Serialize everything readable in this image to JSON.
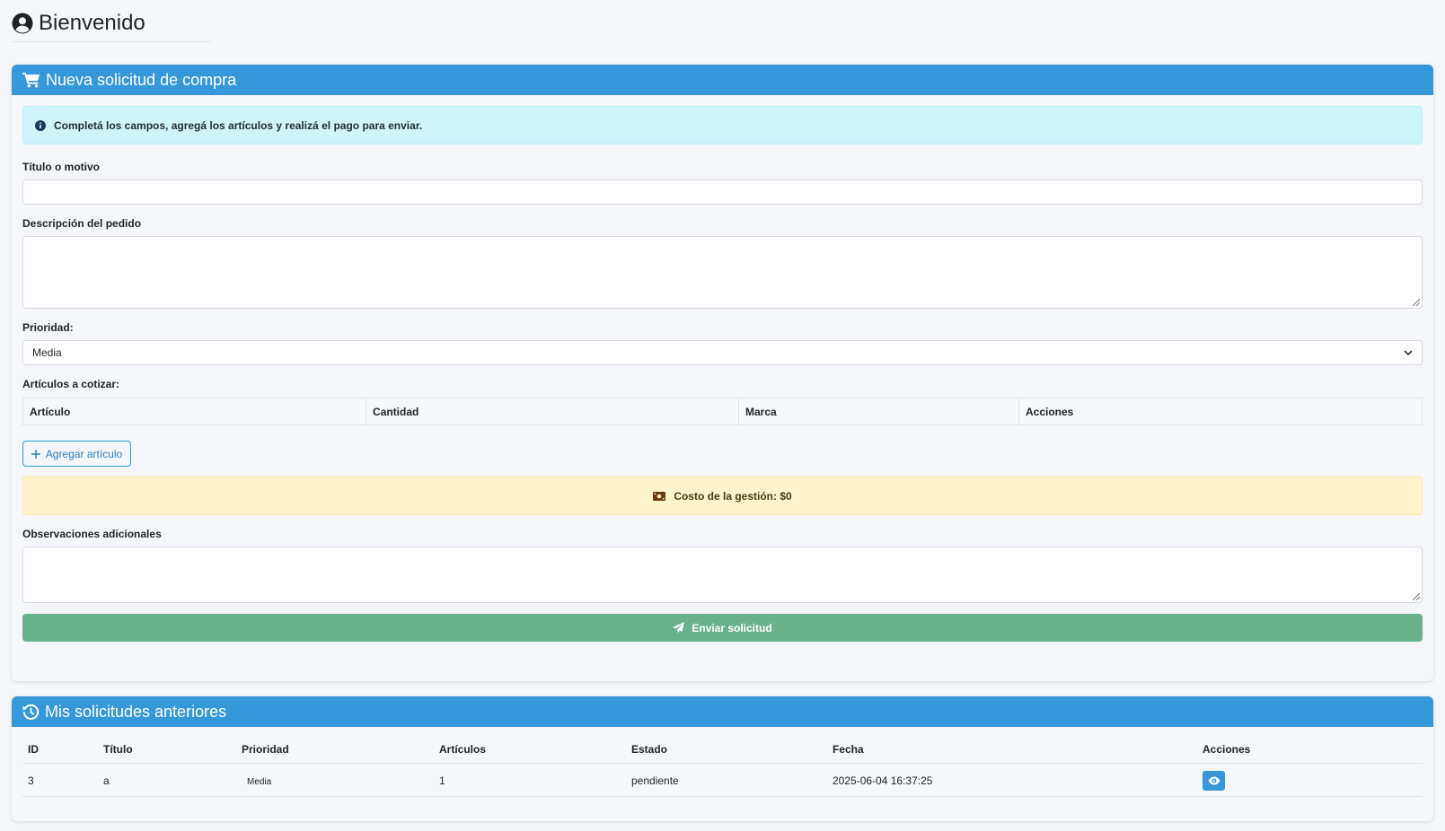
{
  "header": {
    "title": "Bienvenido",
    "icon": "user-circle-icon"
  },
  "new_request": {
    "title": "Nueva solicitud de compra",
    "icon": "cart-icon",
    "info_text": "Completá los campos, agregá los artículos y realizá el pago para enviar.",
    "title_label": "Título o motivo",
    "title_value": "",
    "description_label": "Descripción del pedido",
    "description_value": "",
    "priority_label": "Prioridad:",
    "priority_value": "Media",
    "articles_label": "Artículos a cotizar:",
    "articles_columns": [
      "Artículo",
      "Cantidad",
      "Marca",
      "Acciones"
    ],
    "add_article_label": "Agregar artículo",
    "cost_text": "Costo de la gestión: $0",
    "observations_label": "Observaciones adicionales",
    "observations_value": "",
    "submit_label": "Enviar solicitud"
  },
  "history": {
    "title": "Mis solicitudes anteriores",
    "icon": "history-icon",
    "columns": [
      "ID",
      "Título",
      "Prioridad",
      "Artículos",
      "Estado",
      "Fecha",
      "Acciones"
    ],
    "rows": [
      {
        "id": "3",
        "titulo": "a",
        "prioridad": "Media",
        "articulos": "1",
        "estado": "pendiente",
        "fecha": "2025-06-04 16:37:25",
        "action_icon": "eye-icon"
      }
    ]
  },
  "colors": {
    "primary": "#3498db",
    "success": "#6ab18e",
    "info_bg": "#cff4fc",
    "warning_bg": "#fff3cd"
  }
}
